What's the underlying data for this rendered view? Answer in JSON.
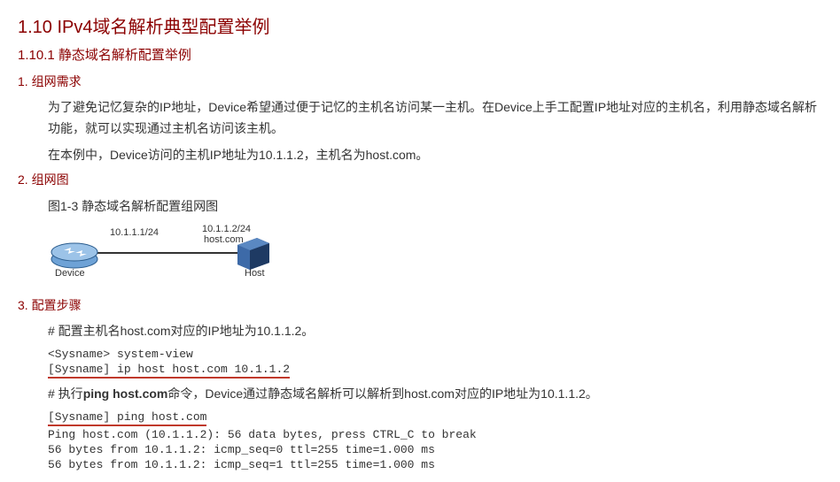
{
  "headings": {
    "h1": "1.10  IPv4域名解析典型配置举例",
    "h2": "1.10.1  静态域名解析配置举例",
    "s1": "1. 组网需求",
    "s2": "2. 组网图",
    "s3": "3. 配置步骤"
  },
  "req": {
    "p1": "为了避免记忆复杂的IP地址，Device希望通过便于记忆的主机名访问某一主机。在Device上手工配置IP地址对应的主机名，利用静态域名解析功能，就可以实现通过主机名访问该主机。",
    "p2": "在本例中，Device访问的主机IP地址为10.1.1.2，主机名为host.com。"
  },
  "figure": {
    "caption": "图1-3 静态域名解析配置组网图",
    "ip1": "10.1.1.1/24",
    "ip2": "10.1.1.2/24",
    "hostdomain": "host.com",
    "device_label": "Device",
    "host_label": "Host"
  },
  "steps": {
    "desc1": "# 配置主机名host.com对应的IP地址为10.1.1.2。",
    "c1": "<Sysname> system-view",
    "c2": "[Sysname] ip host host.com 10.1.1.2",
    "desc2_a": "# 执行",
    "desc2_b": "ping host.com",
    "desc2_c": "命令，Device通过静态域名解析可以解析到host.com对应的IP地址为10.1.1.2。",
    "c3": "[Sysname] ping host.com",
    "o1": "Ping host.com (10.1.1.2): 56 data bytes, press CTRL_C to break",
    "o2": "56 bytes from 10.1.1.2: icmp_seq=0 ttl=255 time=1.000 ms",
    "o3": "56 bytes from 10.1.1.2: icmp_seq=1 ttl=255 time=1.000 ms"
  }
}
